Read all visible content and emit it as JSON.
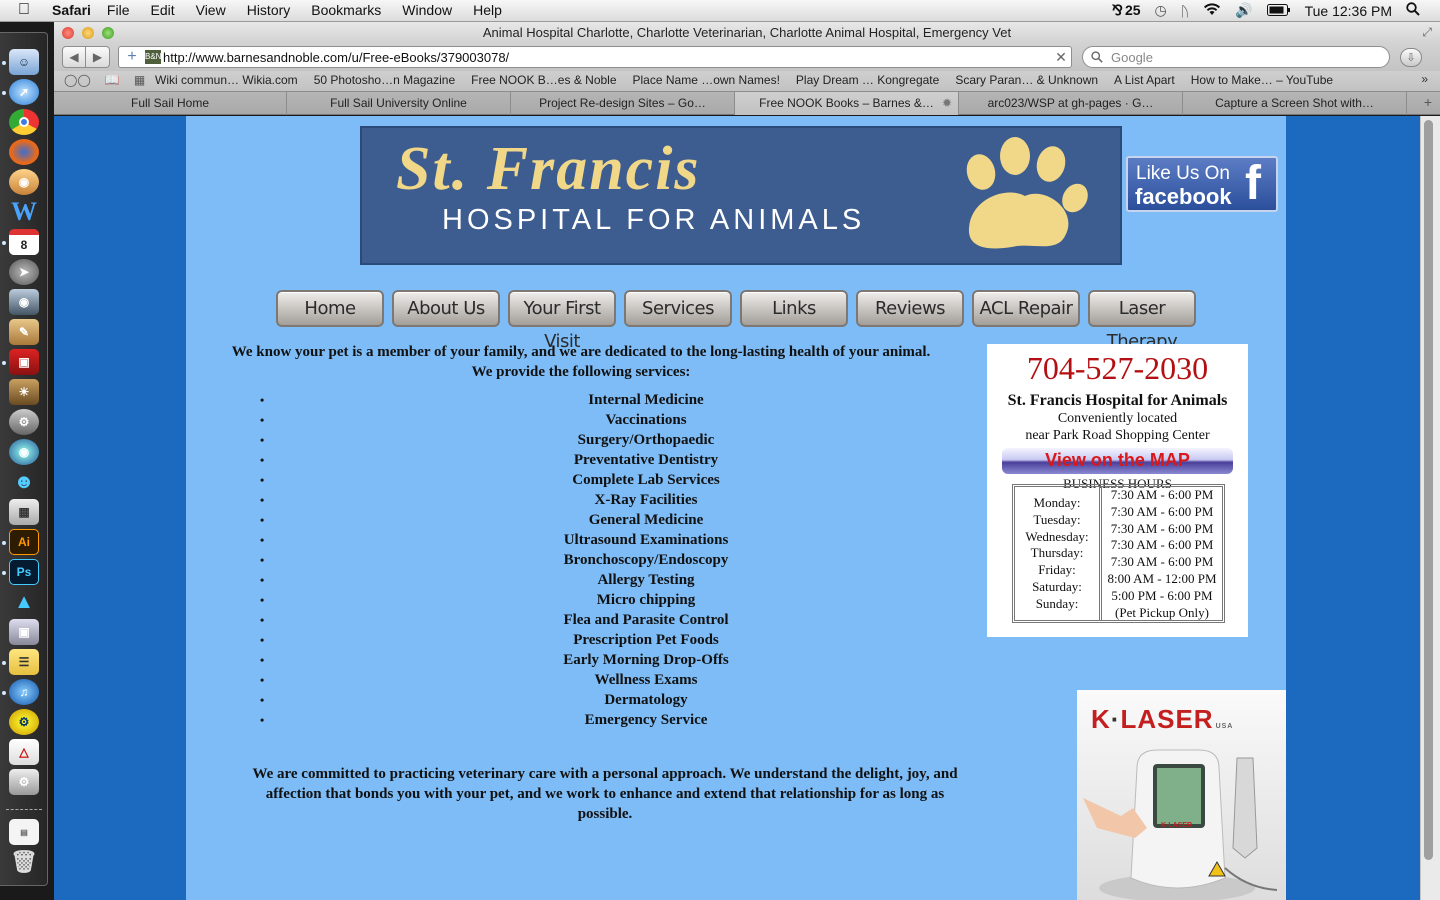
{
  "menubar": {
    "app_name": "Safari",
    "menus": [
      "File",
      "Edit",
      "View",
      "History",
      "Bookmarks",
      "Window",
      "Help"
    ],
    "status_adobe": "25",
    "clock": "Tue 12:36 PM"
  },
  "window": {
    "title": "Animal Hospital Charlotte, Charlotte Veterinarian, Charlotte Animal Hospital, Emergency Vet",
    "url": "http://www.barnesandnoble.com/u/Free-eBooks/379003078/",
    "search_placeholder": "Google",
    "favicon_text": "B&N"
  },
  "bookmarks": [
    "Wiki commun… Wikia.com",
    "50 Photosho…n Magazine",
    "Free NOOK B…es & Noble",
    "Place Name …own Names!",
    "Play Dream … Kongregate",
    "Scary Paran… & Unknown",
    "A List Apart",
    "How to Make… – YouTube"
  ],
  "tabs": [
    {
      "label": "Full Sail Home"
    },
    {
      "label": "Full Sail University Online"
    },
    {
      "label": "Project Re-design Sites – Go…"
    },
    {
      "label": "Free NOOK Books – Barnes &…"
    },
    {
      "label": "arc023/WSP at gh-pages · G…"
    },
    {
      "label": "Capture a Screen Shot with…"
    }
  ],
  "dock": {
    "calendar_day": "8",
    "illustrator_label": "Ai",
    "photoshop_label": "Ps"
  },
  "page": {
    "banner_title": "St. Francis",
    "banner_subtitle": "HOSPITAL FOR ANIMALS",
    "facebook_line1": "Like Us On",
    "facebook_line2": "facebook",
    "facebook_icon": "f",
    "nav": [
      "Home",
      "About Us",
      "Your First Visit",
      "Services",
      "Links",
      "Reviews",
      "ACL Repair",
      "Laser Therapy"
    ],
    "intro": "We know your pet is a member of your family, and we are dedicated to the long-lasting health of your animal. We provide the following services:",
    "bullet_glyph": "•",
    "services": [
      "Internal Medicine",
      "Vaccinations",
      "Surgery/Orthopaedic",
      "Preventative Dentistry",
      "Complete Lab Services",
      "X-Ray Facilities",
      "General Medicine",
      "Ultrasound Examinations",
      "Bronchoscopy/Endoscopy",
      "Allergy Testing",
      "Micro chipping",
      "Flea and Parasite Control",
      "Prescription Pet Foods",
      "Early Morning Drop-Offs",
      "Wellness Exams",
      "Dermatology",
      "Emergency Service"
    ],
    "closing": "We are committed to practicing veterinary care with a personal approach. We understand the delight, joy, and affection that bonds you with your pet, and we work to enhance and extend that relationship for as long as possible."
  },
  "contact": {
    "phone": "704-527-2030",
    "name": "St. Francis Hospital for Animals",
    "location_line1": "Conveniently located",
    "location_line2": "near Park Road Shopping Center",
    "map_button": "View on the MAP",
    "hours_title": "BUSINESS HOURS",
    "days": [
      "Monday:",
      "Tuesday:",
      "Wednesday:",
      "Thursday:",
      "Friday:",
      "Saturday:",
      "Sunday:"
    ],
    "times": [
      "7:30 AM - 6:00 PM",
      "7:30 AM - 6:00 PM",
      "7:30 AM - 6:00 PM",
      "7:30 AM - 6:00 PM",
      "7:30 AM - 6:00 PM",
      "8:00 AM - 12:00 PM",
      "5:00 PM - 6:00 PM",
      "(Pet Pickup Only)"
    ]
  },
  "ad": {
    "logo_k": "K",
    "logo_rest": "LASER",
    "logo_suffix": "USA",
    "device_brand": "K-LASER"
  },
  "colors": {
    "page_background": "#7dbcf6",
    "outer_background": "#1c6abf",
    "banner_blue": "#3d5c8f",
    "banner_gold": "#f1d788",
    "phone_red": "#b40f12"
  }
}
